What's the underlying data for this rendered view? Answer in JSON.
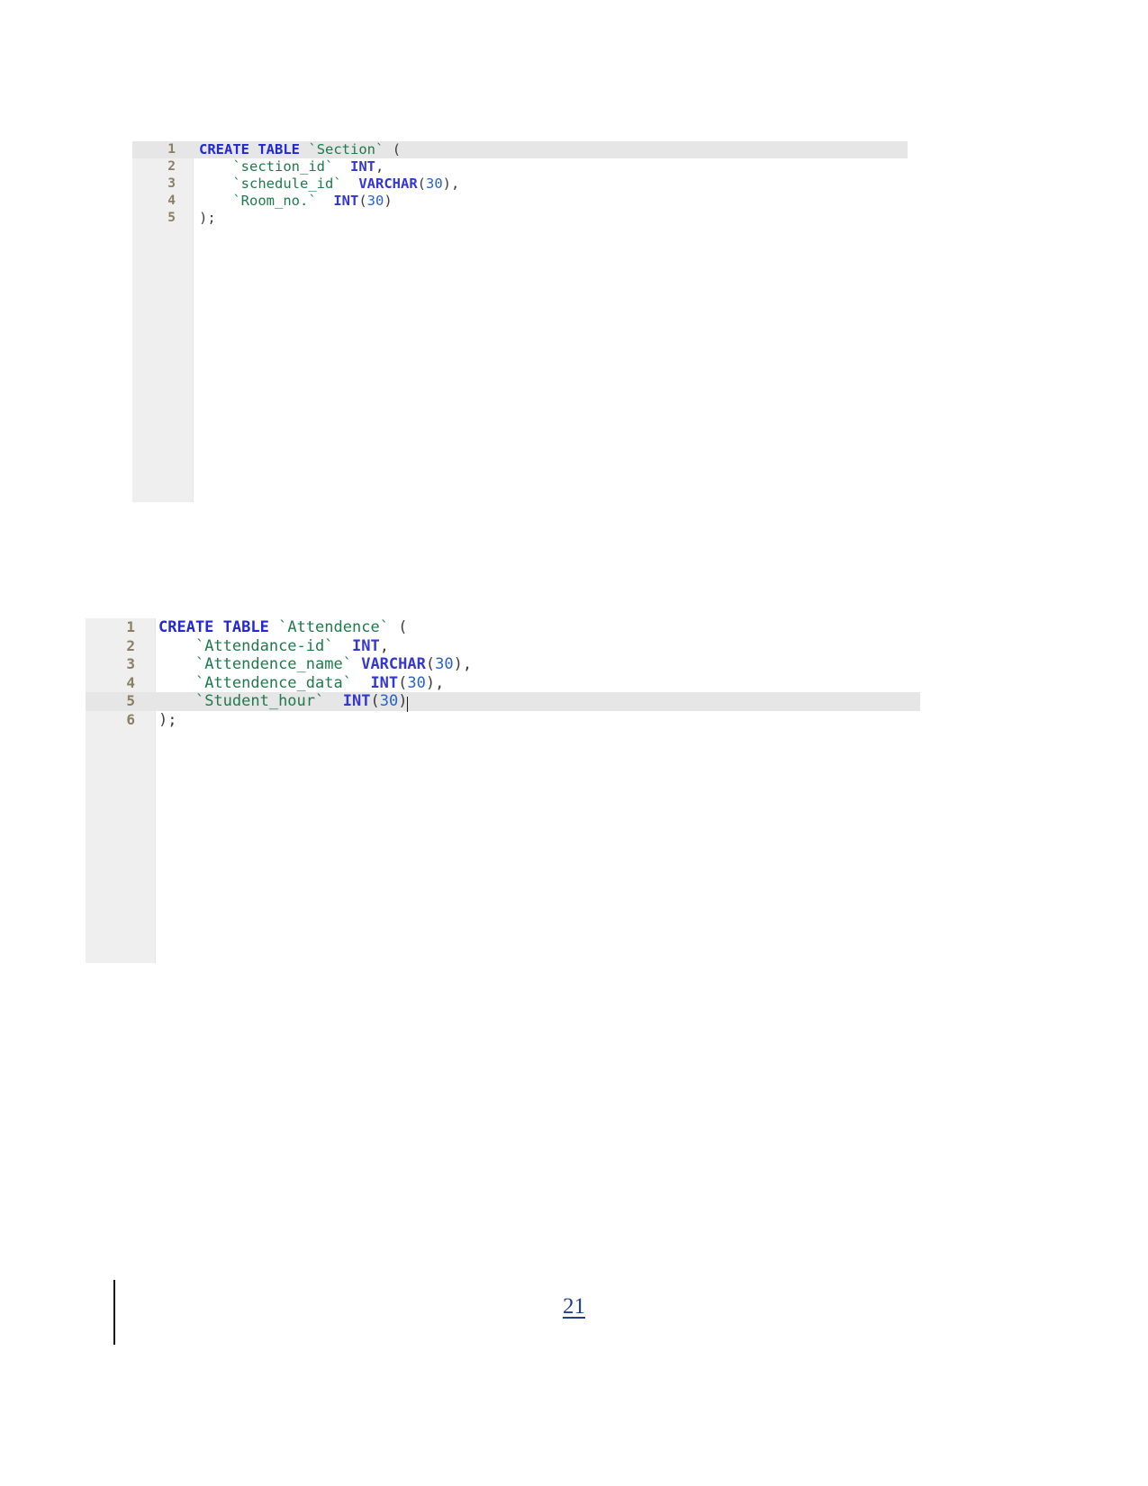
{
  "document": {
    "page_number": "21",
    "background_color": "#ffffff"
  },
  "theme": {
    "gutter_background": "#efefef",
    "current_line_background": "#e6e6e6",
    "line_number_color": "#8a7f63",
    "keyword_color": "#2128d4",
    "identifier_color": "#1f7a4d",
    "type_color": "#3438d0",
    "number_color": "#2a62c8",
    "page_number_color": "#1f3f8f"
  },
  "code_blocks": [
    {
      "id": "section-table",
      "name": "Section table DDL",
      "language": "sql",
      "current_line": 1,
      "line_numbers": [
        "1",
        "2",
        "3",
        "4",
        "5"
      ],
      "lines": [
        {
          "number": "1",
          "text": "CREATE TABLE `Section` (",
          "tokens": [
            {
              "t": "CREATE",
              "c": "kw"
            },
            {
              "t": " ",
              "c": "punct"
            },
            {
              "t": "TABLE",
              "c": "kw"
            },
            {
              "t": " ",
              "c": "punct"
            },
            {
              "t": "`Section`",
              "c": "ident"
            },
            {
              "t": " ",
              "c": "punct"
            },
            {
              "t": "(",
              "c": "paren"
            }
          ]
        },
        {
          "number": "2",
          "text": "    `section_id` INT,",
          "tokens": [
            {
              "t": "    ",
              "c": "punct"
            },
            {
              "t": "`section_id`",
              "c": "ident"
            },
            {
              "t": "  ",
              "c": "punct"
            },
            {
              "t": "INT",
              "c": "type"
            },
            {
              "t": ",",
              "c": "punct"
            }
          ]
        },
        {
          "number": "3",
          "text": "    `schedule_id` VARCHAR(30),",
          "tokens": [
            {
              "t": "    ",
              "c": "punct"
            },
            {
              "t": "`schedule_id`",
              "c": "ident"
            },
            {
              "t": "  ",
              "c": "punct"
            },
            {
              "t": "VARCHAR",
              "c": "type"
            },
            {
              "t": "(",
              "c": "paren"
            },
            {
              "t": "30",
              "c": "num"
            },
            {
              "t": ")",
              "c": "paren"
            },
            {
              "t": ",",
              "c": "punct"
            }
          ]
        },
        {
          "number": "4",
          "text": "    `Room_no.` INT(30)",
          "tokens": [
            {
              "t": "    ",
              "c": "punct"
            },
            {
              "t": "`Room_no.`",
              "c": "ident"
            },
            {
              "t": "  ",
              "c": "punct"
            },
            {
              "t": "INT",
              "c": "type"
            },
            {
              "t": "(",
              "c": "paren"
            },
            {
              "t": "30",
              "c": "num"
            },
            {
              "t": ")",
              "c": "paren"
            }
          ]
        },
        {
          "number": "5",
          "text": ");",
          "tokens": [
            {
              "t": ")",
              "c": "paren"
            },
            {
              "t": ";",
              "c": "punct"
            }
          ]
        }
      ]
    },
    {
      "id": "attendence-table",
      "name": "Attendence table DDL",
      "language": "sql",
      "current_line": 5,
      "has_caret": true,
      "caret_line": 5,
      "line_numbers": [
        "1",
        "2",
        "3",
        "4",
        "5",
        "6"
      ],
      "lines": [
        {
          "number": "1",
          "text": "CREATE TABLE `Attendence` (",
          "tokens": [
            {
              "t": "CREATE",
              "c": "kw"
            },
            {
              "t": " ",
              "c": "punct"
            },
            {
              "t": "TABLE",
              "c": "kw"
            },
            {
              "t": " ",
              "c": "punct"
            },
            {
              "t": "`Attendence`",
              "c": "ident"
            },
            {
              "t": " ",
              "c": "punct"
            },
            {
              "t": "(",
              "c": "paren"
            }
          ]
        },
        {
          "number": "2",
          "text": "    `Attendance-id` INT,",
          "tokens": [
            {
              "t": "    ",
              "c": "punct"
            },
            {
              "t": "`Attendance-id`",
              "c": "ident"
            },
            {
              "t": "  ",
              "c": "punct"
            },
            {
              "t": "INT",
              "c": "type"
            },
            {
              "t": ",",
              "c": "punct"
            }
          ]
        },
        {
          "number": "3",
          "text": "    `Attendence_name` VARCHAR(30),",
          "tokens": [
            {
              "t": "    ",
              "c": "punct"
            },
            {
              "t": "`Attendence_name`",
              "c": "ident"
            },
            {
              "t": " ",
              "c": "punct"
            },
            {
              "t": "VARCHAR",
              "c": "type"
            },
            {
              "t": "(",
              "c": "paren"
            },
            {
              "t": "30",
              "c": "num"
            },
            {
              "t": ")",
              "c": "paren"
            },
            {
              "t": ",",
              "c": "punct"
            }
          ]
        },
        {
          "number": "4",
          "text": "    `Attendence_data` INT(30),",
          "tokens": [
            {
              "t": "    ",
              "c": "punct"
            },
            {
              "t": "`Attendence_data`",
              "c": "ident"
            },
            {
              "t": "  ",
              "c": "punct"
            },
            {
              "t": "INT",
              "c": "type"
            },
            {
              "t": "(",
              "c": "paren"
            },
            {
              "t": "30",
              "c": "num"
            },
            {
              "t": ")",
              "c": "paren"
            },
            {
              "t": ",",
              "c": "punct"
            }
          ]
        },
        {
          "number": "5",
          "text": "    `Student_hour` INT(30)",
          "tokens": [
            {
              "t": "    ",
              "c": "punct"
            },
            {
              "t": "`Student_hour`",
              "c": "ident"
            },
            {
              "t": "  ",
              "c": "punct"
            },
            {
              "t": "INT",
              "c": "type"
            },
            {
              "t": "(",
              "c": "paren"
            },
            {
              "t": "30",
              "c": "num"
            },
            {
              "t": ")",
              "c": "paren"
            }
          ]
        },
        {
          "number": "6",
          "text": ");",
          "tokens": [
            {
              "t": ")",
              "c": "paren"
            },
            {
              "t": ";",
              "c": "punct"
            }
          ]
        }
      ]
    }
  ]
}
